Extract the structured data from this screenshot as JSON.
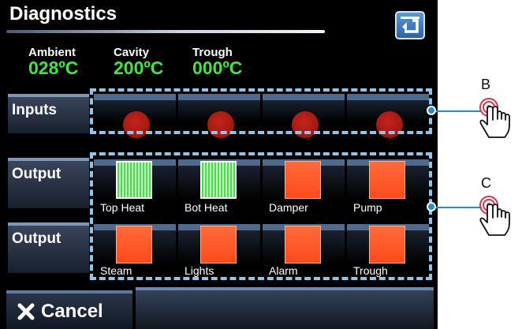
{
  "header": {
    "title": "Diagnostics",
    "back_icon": "return-arrow-icon"
  },
  "temps": [
    {
      "label": "Ambient",
      "value": "028ºC"
    },
    {
      "label": "Cavity",
      "value": "200ºC"
    },
    {
      "label": "Trough",
      "value": "000ºC"
    }
  ],
  "inputs": {
    "label": "Inputs",
    "states": [
      "red",
      "red",
      "red",
      "red"
    ]
  },
  "outputs_row1": {
    "label": "Output",
    "items": [
      {
        "label": "Top Heat",
        "state": "on"
      },
      {
        "label": "Bot Heat",
        "state": "on"
      },
      {
        "label": "Damper",
        "state": "off"
      },
      {
        "label": "Pump",
        "state": "off"
      }
    ]
  },
  "outputs_row2": {
    "label": "Output",
    "items": [
      {
        "label": "Steam",
        "state": "off"
      },
      {
        "label": "Lights",
        "state": "off"
      },
      {
        "label": "Alarm",
        "state": "off"
      },
      {
        "label": "Trough",
        "state": "off"
      }
    ]
  },
  "cancel": {
    "label": "Cancel",
    "icon": "x-icon"
  },
  "callouts": [
    {
      "letter": "B",
      "icon": "touch-hand-icon"
    },
    {
      "letter": "C",
      "icon": "touch-hand-icon"
    }
  ],
  "colors": {
    "accent_blue": "#1d8fd2",
    "temp_green": "#3ee63e",
    "output_off": "#ff4a1a",
    "output_on": "#43e043",
    "input_led": "#c5231a"
  }
}
